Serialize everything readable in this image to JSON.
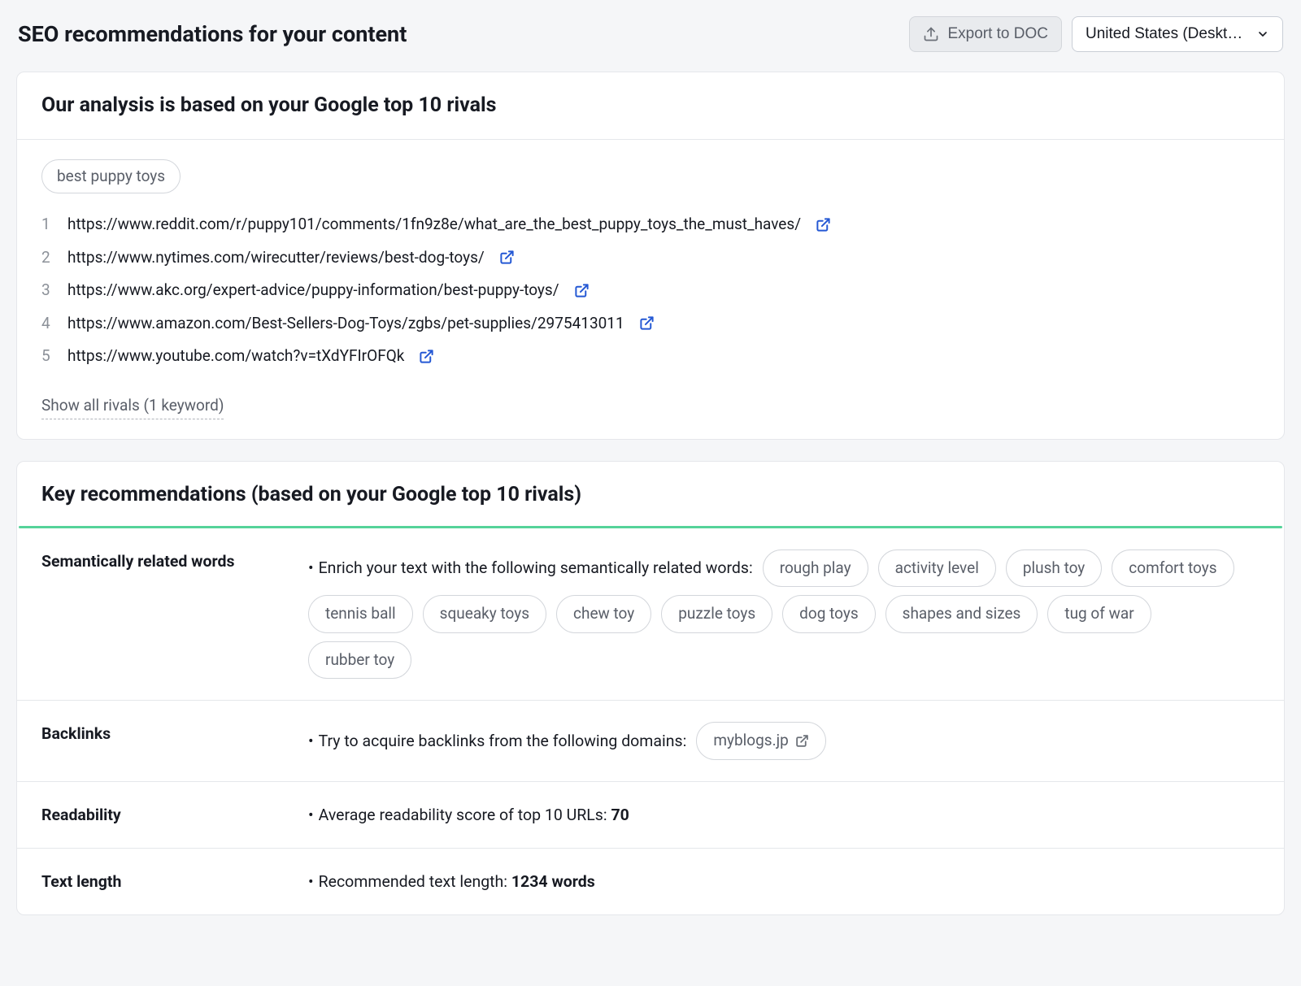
{
  "header": {
    "title": "SEO recommendations for your content",
    "export_label": "Export to DOC",
    "region_select": "United States (Desktop)"
  },
  "analysis": {
    "title": "Our analysis is based on your Google top 10 rivals",
    "keyword": "best puppy toys",
    "rivals": [
      {
        "n": "1",
        "url": "https://www.reddit.com/r/puppy101/comments/1fn9z8e/what_are_the_best_puppy_toys_the_must_haves/"
      },
      {
        "n": "2",
        "url": "https://www.nytimes.com/wirecutter/reviews/best-dog-toys/"
      },
      {
        "n": "3",
        "url": "https://www.akc.org/expert-advice/puppy-information/best-puppy-toys/"
      },
      {
        "n": "4",
        "url": "https://www.amazon.com/Best-Sellers-Dog-Toys/zgbs/pet-supplies/2975413011"
      },
      {
        "n": "5",
        "url": "https://www.youtube.com/watch?v=tXdYFIrOFQk"
      }
    ],
    "show_all": "Show all rivals (1 keyword)"
  },
  "key": {
    "title": "Key recommendations (based on your Google top 10 rivals)",
    "rows": {
      "semantic": {
        "label": "Semantically related words",
        "lead": "Enrich your text with the following semantically related words:",
        "words": [
          "rough play",
          "activity level",
          "plush toy",
          "comfort toys",
          "tennis ball",
          "squeaky toys",
          "chew toy",
          "puzzle toys",
          "dog toys",
          "shapes and sizes",
          "tug of war",
          "rubber toy"
        ]
      },
      "backlinks": {
        "label": "Backlinks",
        "lead": "Try to acquire backlinks from the following domains:",
        "domains": [
          "myblogs.jp"
        ]
      },
      "readability": {
        "label": "Readability",
        "lead": "Average readability score of top 10 URLs: ",
        "value": "70"
      },
      "textlen": {
        "label": "Text length",
        "lead": "Recommended text length: ",
        "value": "1234 words"
      }
    }
  }
}
